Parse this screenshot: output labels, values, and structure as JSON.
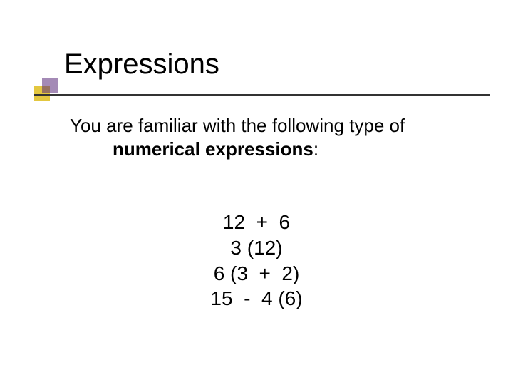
{
  "title": "Expressions",
  "body": {
    "line1": "You are familiar with the following type of",
    "bold2": "numerical expressions",
    "tail2": ":"
  },
  "expr": {
    "e1": "12  +  6",
    "e2": "3 (12)",
    "e3": "6 (3  +  2)",
    "e4": "15  -  4 (6)"
  }
}
